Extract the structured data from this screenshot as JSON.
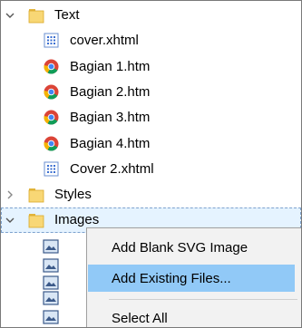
{
  "tree": {
    "text_folder": {
      "label": "Text",
      "expanded": true,
      "icon": "folder-icon"
    },
    "files": [
      {
        "label": "cover.xhtml",
        "icon": "xhtml-grid-icon"
      },
      {
        "label": "Bagian 1.htm",
        "icon": "chrome-html-icon"
      },
      {
        "label": "Bagian 2.htm",
        "icon": "chrome-html-icon"
      },
      {
        "label": "Bagian 3.htm",
        "icon": "chrome-html-icon"
      },
      {
        "label": "Bagian 4.htm",
        "icon": "chrome-html-icon"
      },
      {
        "label": "Cover 2.xhtml",
        "icon": "xhtml-grid-icon"
      }
    ],
    "styles_folder": {
      "label": "Styles",
      "expanded": false,
      "icon": "folder-icon"
    },
    "images_folder": {
      "label": "Images",
      "expanded": true,
      "selected": true,
      "icon": "folder-icon"
    }
  },
  "context_menu": {
    "items": [
      {
        "label": "Add Blank SVG Image",
        "highlighted": false
      },
      {
        "label": "Add Existing Files...",
        "highlighted": true
      },
      {
        "label": "Select All",
        "highlighted": false
      }
    ]
  },
  "colors": {
    "selection_bg": "#e5f3ff",
    "menu_highlight": "#91c9f7",
    "folder_yellow": "#f8d775"
  }
}
